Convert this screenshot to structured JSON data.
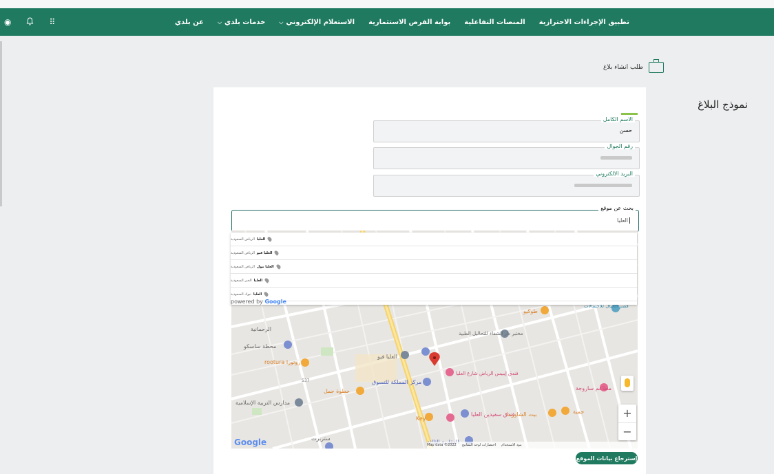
{
  "nav": {
    "items": [
      {
        "label": "عن بلدي",
        "dropdown": false
      },
      {
        "label": "خدمات بلدي",
        "dropdown": true
      },
      {
        "label": "الاستعلام الإلكتروني",
        "dropdown": true
      },
      {
        "label": "بوابة الفرص الاستثمارية",
        "dropdown": false
      },
      {
        "label": "المنصات التفاعلية",
        "dropdown": false
      },
      {
        "label": "تطبيق الإجراءات الاحترازية",
        "dropdown": false
      }
    ],
    "chevron": "⌵",
    "icons": {
      "apps": "⠿",
      "bell": "🔔",
      "globe": "◉"
    }
  },
  "breadcrumb": {
    "label": "طلب انشاء بلاغ"
  },
  "form": {
    "title": "نموذج البلاغ",
    "full_name_label": "الاسم الكامل",
    "full_name_value": "حسن",
    "phone_label": "رقم الجوال",
    "email_label": "البريد الالكتروني",
    "search_label": "بحث عن موقع",
    "search_value": "العليا"
  },
  "suggestions": [
    {
      "bold": "العليا",
      "rest": "الرياض السعودية"
    },
    {
      "bold": "العليا فيو",
      "rest": "الرياض السعودية"
    },
    {
      "bold": "العليا مول",
      "rest": "الرياض السعودية"
    },
    {
      "bold": "العليا",
      "rest": "الخبر السعودية"
    },
    {
      "bold": "العليا",
      "rest": "تبوك السعودية"
    }
  ],
  "powered_by": {
    "text": "powered by",
    "brand": "Google"
  },
  "map": {
    "labels": [
      "الرحمانية",
      "محطة ساسكو",
      "rootura روتورا",
      "حطوة جمل",
      "مدارس التربية الإسلامية",
      "العليا فيو",
      "مختبر دار الشفاء للتحاليل الطبية",
      "فندق إيبيس الرياض شارع العليا",
      "مركز المملكة للتسوق",
      "فندق سفيدين العليا",
      "مطاعم ساروجة",
      "Key",
      "طوكيو",
      "قصر الخيال للاحتفالات",
      "جمبة",
      "العقارية الثالثة",
      "ستربرت",
      "بيت الشاورما",
      "537"
    ],
    "footer_items": [
      "Map data ©2022",
      "اختصارات لوحة المفاتيح",
      "بنود الاستخدام"
    ],
    "google_logo": "Google"
  },
  "fetch_button": {
    "label": "إسترجاع بيانات الموقع"
  },
  "colors": {
    "primary": "#1f7a5f",
    "accent": "#8bc34a"
  }
}
